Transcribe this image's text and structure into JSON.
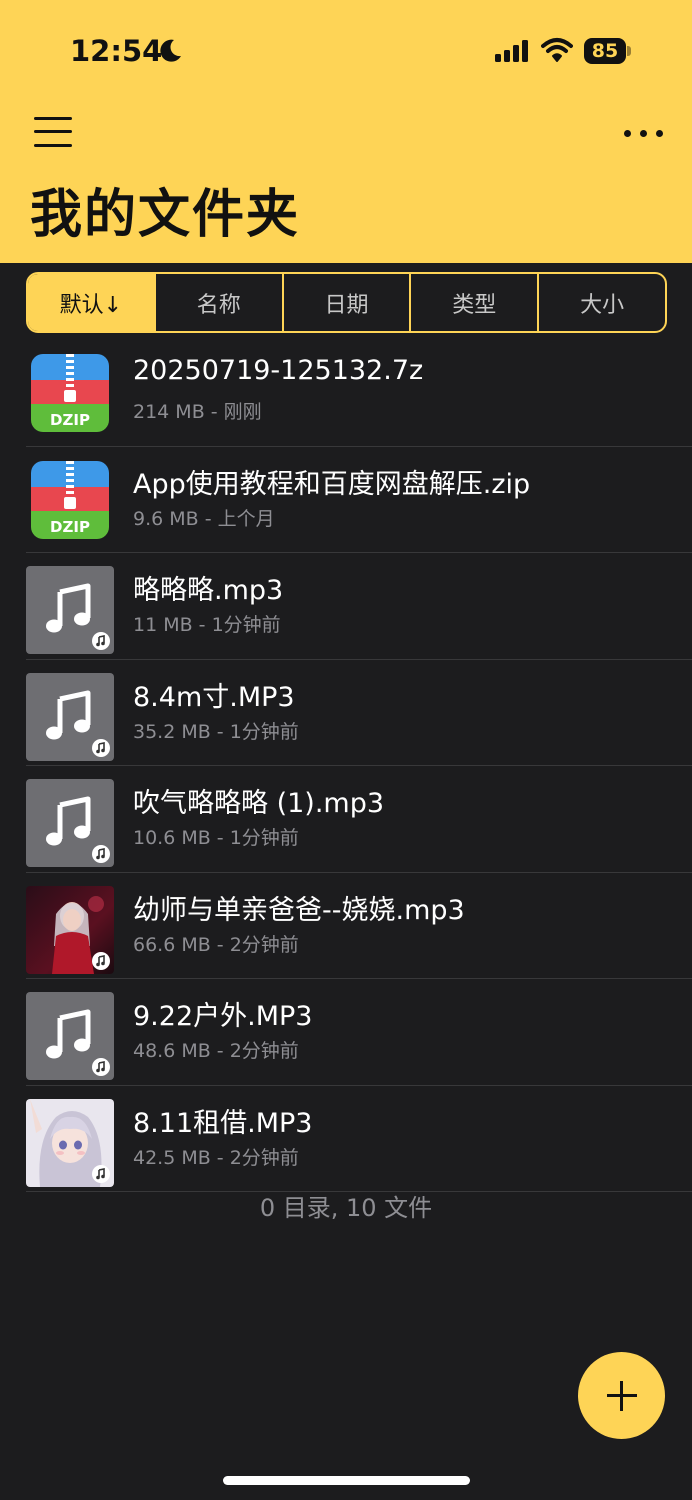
{
  "status": {
    "time": "12:54",
    "battery": "85"
  },
  "header": {
    "title": "我的文件夹"
  },
  "sort": {
    "tabs": [
      "默认↓",
      "名称",
      "日期",
      "类型",
      "大小"
    ]
  },
  "files": [
    {
      "name": "20250719-125132.7z",
      "meta": "214 MB - 刚刚",
      "icon": "zip",
      "badge_text": "DZIP"
    },
    {
      "name": "App使用教程和百度网盘解压.zip",
      "meta": "9.6 MB - 上个月",
      "icon": "zip",
      "badge_text": "DZIP"
    },
    {
      "name": "略略略.mp3",
      "meta": "11 MB - 1分钟前",
      "icon": "music"
    },
    {
      "name": "8.4m寸.MP3",
      "meta": "35.2 MB - 1分钟前",
      "icon": "music"
    },
    {
      "name": "吹气略略略 (1).mp3",
      "meta": "10.6 MB - 1分钟前",
      "icon": "music"
    },
    {
      "name": "幼师与单亲爸爸--娆娆.mp3",
      "meta": "66.6 MB - 2分钟前",
      "icon": "album-art-red"
    },
    {
      "name": "9.22户外.MP3",
      "meta": "48.6 MB - 2分钟前",
      "icon": "music"
    },
    {
      "name": "8.11租借.MP3",
      "meta": "42.5 MB - 2分钟前",
      "icon": "album-art-anime"
    }
  ],
  "summary": "0 目录, 10 文件",
  "colors": {
    "accent": "#fed456",
    "background": "#1c1c1e",
    "secondary_text": "#8e8e93"
  }
}
